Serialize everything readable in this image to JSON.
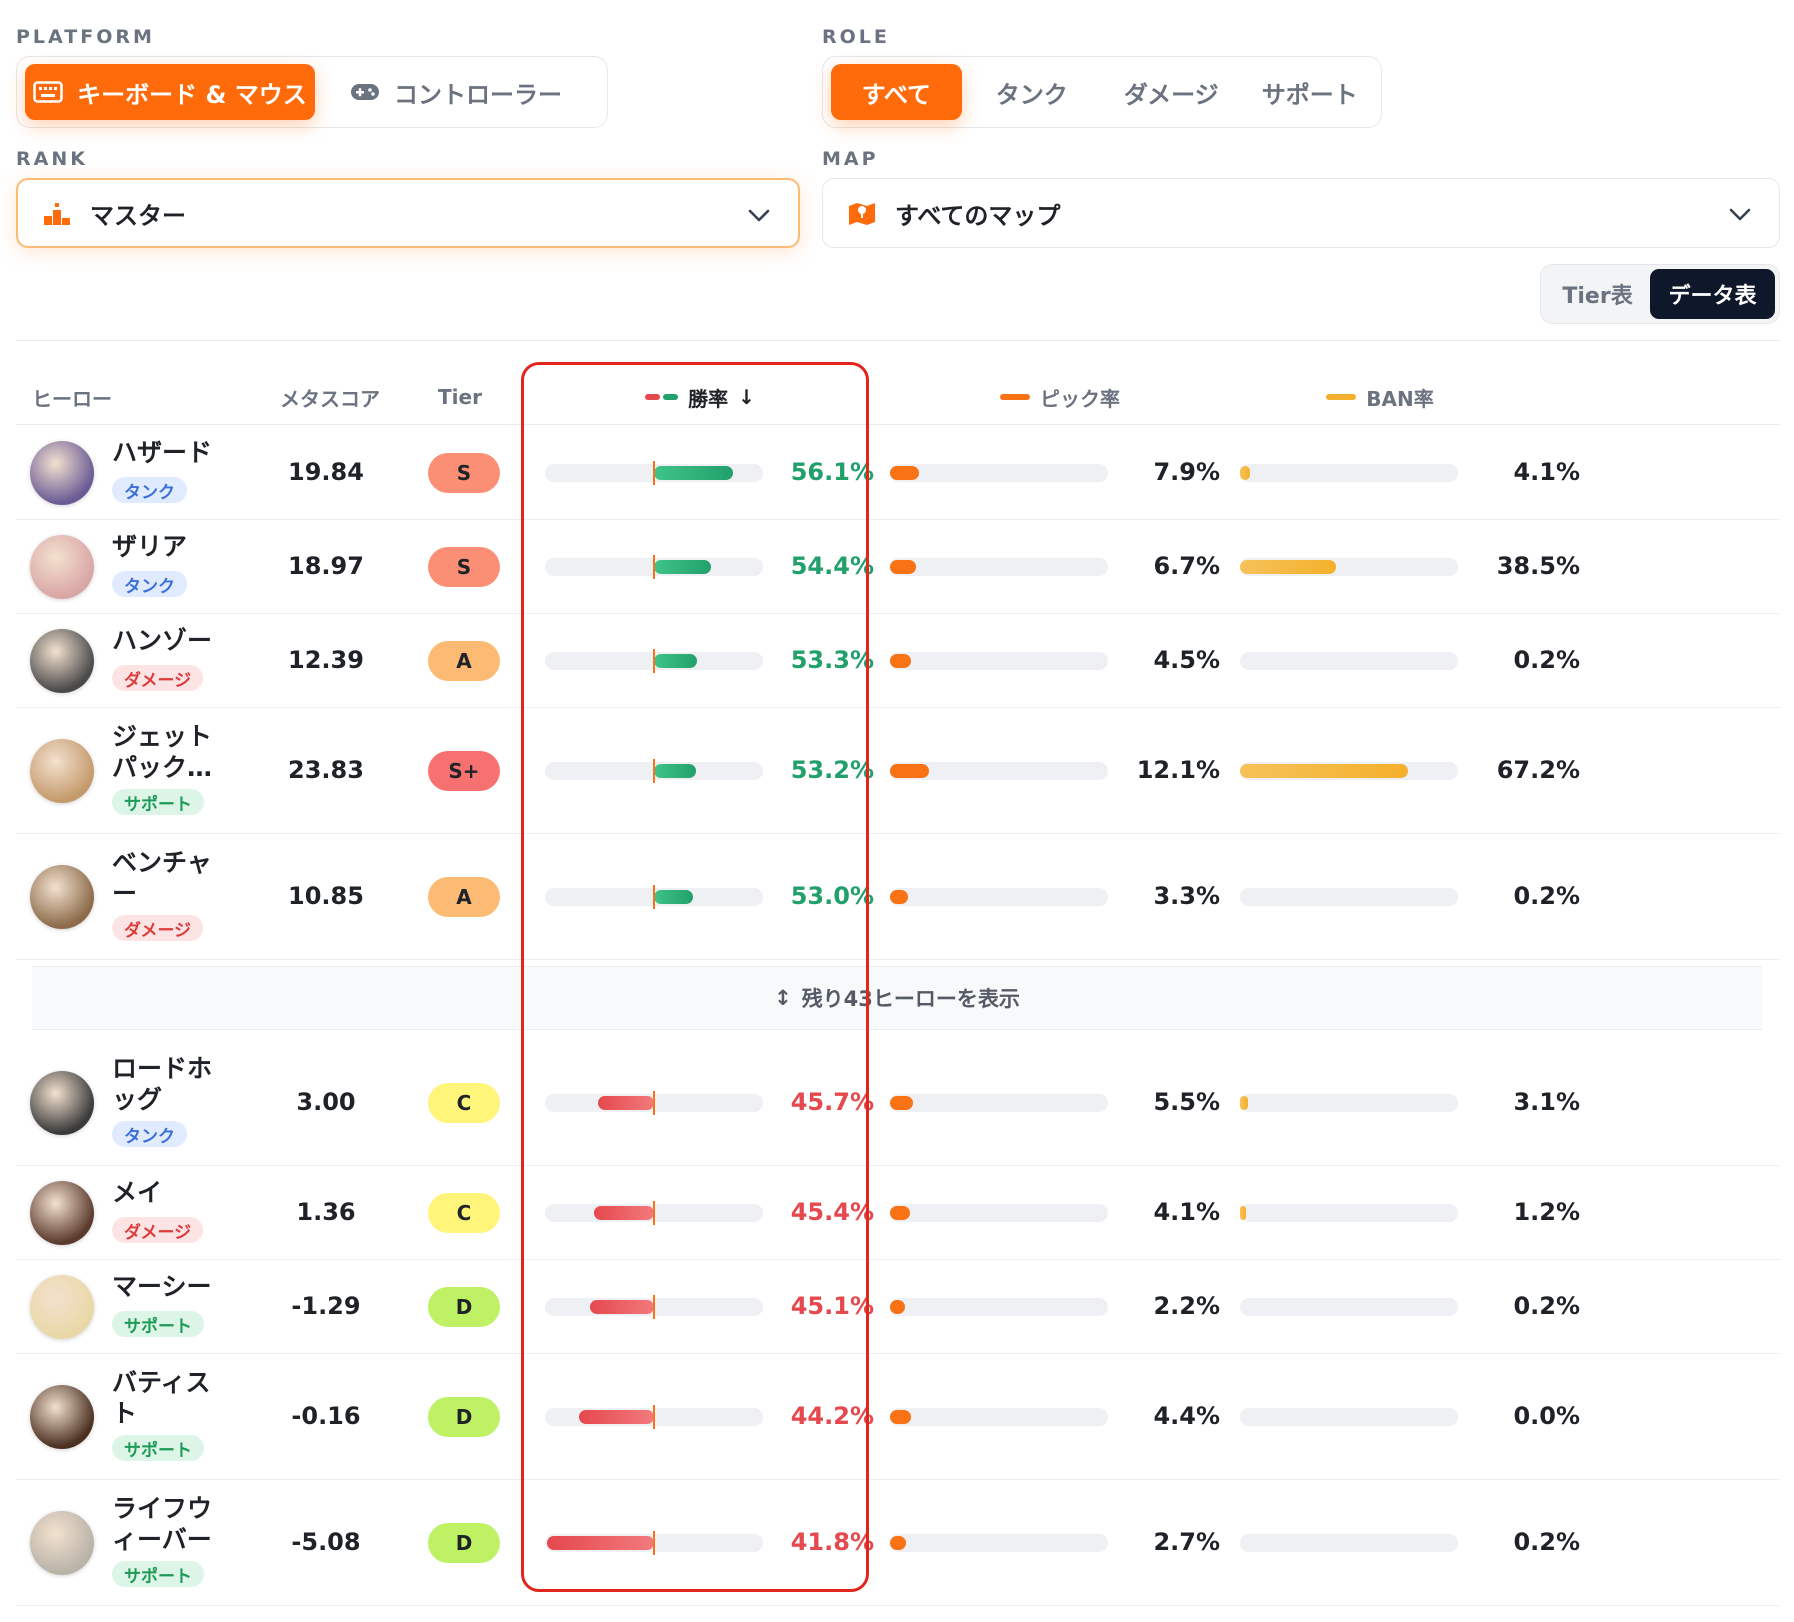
{
  "platform": {
    "label": "PLATFORM",
    "options": [
      {
        "label": "キーボード & マウス",
        "icon": "keyboard-icon",
        "active": true
      },
      {
        "label": "コントローラー",
        "icon": "gamepad-icon",
        "active": false
      }
    ]
  },
  "role": {
    "label": "ROLE",
    "options": [
      {
        "label": "すべて",
        "active": true
      },
      {
        "label": "タンク",
        "active": false
      },
      {
        "label": "ダメージ",
        "active": false
      },
      {
        "label": "サポート",
        "active": false
      }
    ]
  },
  "rank": {
    "label": "RANK",
    "value": "マスター",
    "icon": "rank-icon"
  },
  "map": {
    "label": "MAP",
    "value": "すべてのマップ",
    "icon": "map-icon"
  },
  "view_toggle": {
    "tier_label": "Tier表",
    "data_label": "データ表",
    "active": "data"
  },
  "table": {
    "headers": {
      "hero": "ヒーロー",
      "meta": "メタスコア",
      "tier": "Tier",
      "win": "勝率",
      "win_sort": "↓",
      "pick": "ピック率",
      "ban": "BAN率"
    },
    "expand_label": "残り43ヒーローを表示",
    "expand_icon": "↕",
    "colors": {
      "win_up": "#22a06b",
      "win_down": "#e5484d",
      "pick": "#f97316",
      "ban": "#f4b02c"
    },
    "rows_top": [
      {
        "name": "ハザード",
        "role": "タンク",
        "role_type": "tank",
        "meta": "19.84",
        "tier": "S",
        "win": 56.1,
        "win_text": "56.1%",
        "pick": 7.9,
        "pick_text": "7.9%",
        "ban": 4.1,
        "ban_text": "4.1%"
      },
      {
        "name": "ザリア",
        "role": "タンク",
        "role_type": "tank",
        "meta": "18.97",
        "tier": "S",
        "win": 54.4,
        "win_text": "54.4%",
        "pick": 6.7,
        "pick_text": "6.7%",
        "ban": 38.5,
        "ban_text": "38.5%"
      },
      {
        "name": "ハンゾー",
        "role": "ダメージ",
        "role_type": "damage",
        "meta": "12.39",
        "tier": "A",
        "win": 53.3,
        "win_text": "53.3%",
        "pick": 4.5,
        "pick_text": "4.5%",
        "ban": 0.2,
        "ban_text": "0.2%"
      },
      {
        "name": "ジェットパック…",
        "role": "サポート",
        "role_type": "support",
        "meta": "23.83",
        "tier": "S+",
        "win": 53.2,
        "win_text": "53.2%",
        "pick": 12.1,
        "pick_text": "12.1%",
        "ban": 67.2,
        "ban_text": "67.2%"
      },
      {
        "name": "ベンチャー",
        "role": "ダメージ",
        "role_type": "damage",
        "meta": "10.85",
        "tier": "A",
        "win": 53.0,
        "win_text": "53.0%",
        "pick": 3.3,
        "pick_text": "3.3%",
        "ban": 0.2,
        "ban_text": "0.2%"
      }
    ],
    "rows_bottom": [
      {
        "name": "ロードホッグ",
        "role": "タンク",
        "role_type": "tank",
        "meta": "3.00",
        "tier": "C",
        "win": 45.7,
        "win_text": "45.7%",
        "pick": 5.5,
        "pick_text": "5.5%",
        "ban": 3.1,
        "ban_text": "3.1%"
      },
      {
        "name": "メイ",
        "role": "ダメージ",
        "role_type": "damage",
        "meta": "1.36",
        "tier": "C",
        "win": 45.4,
        "win_text": "45.4%",
        "pick": 4.1,
        "pick_text": "4.1%",
        "ban": 1.2,
        "ban_text": "1.2%"
      },
      {
        "name": "マーシー",
        "role": "サポート",
        "role_type": "support",
        "meta": "-1.29",
        "tier": "D",
        "win": 45.1,
        "win_text": "45.1%",
        "pick": 2.2,
        "pick_text": "2.2%",
        "ban": 0.2,
        "ban_text": "0.2%"
      },
      {
        "name": "バティスト",
        "role": "サポート",
        "role_type": "support",
        "meta": "-0.16",
        "tier": "D",
        "win": 44.2,
        "win_text": "44.2%",
        "pick": 4.4,
        "pick_text": "4.4%",
        "ban": 0.0,
        "ban_text": "0.0%"
      },
      {
        "name": "ライフウィーバー",
        "role": "サポート",
        "role_type": "support",
        "meta": "-5.08",
        "tier": "D",
        "win": 41.8,
        "win_text": "41.8%",
        "pick": 2.7,
        "pick_text": "2.7%",
        "ban": 0.2,
        "ban_text": "0.2%"
      }
    ]
  }
}
